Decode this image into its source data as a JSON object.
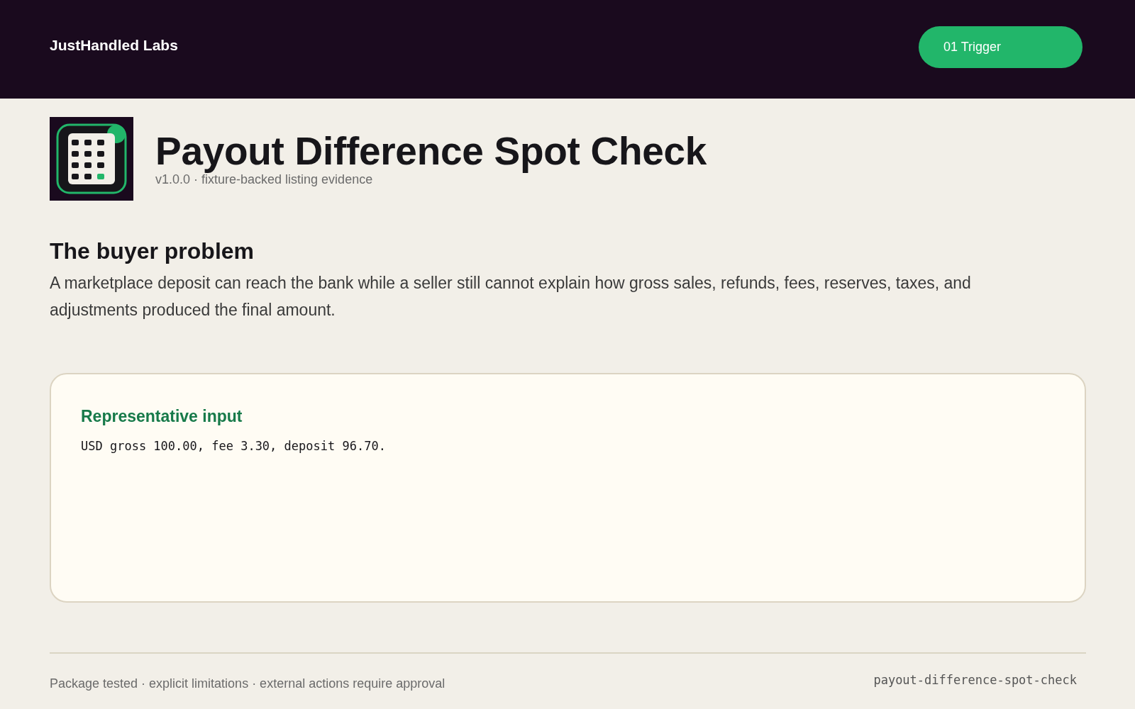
{
  "header": {
    "brand": "JustHandled Labs",
    "action_button": "01 Trigger"
  },
  "hero": {
    "title": "Payout Difference Spot Check",
    "subtitle": "v1.0.0 · fixture-backed listing evidence"
  },
  "problem": {
    "heading": "The buyer problem",
    "body": "A marketplace deposit can reach the bank while a seller still cannot explain how gross sales, refunds, fees, reserves, taxes, and adjustments produced the final amount."
  },
  "card": {
    "heading": "Representative input",
    "body": "USD gross 100.00, fee 3.30, deposit 96.70."
  },
  "footer": {
    "note": "Package tested · explicit limitations · external actions require approval",
    "package_name": "payout-difference-spot-check"
  }
}
